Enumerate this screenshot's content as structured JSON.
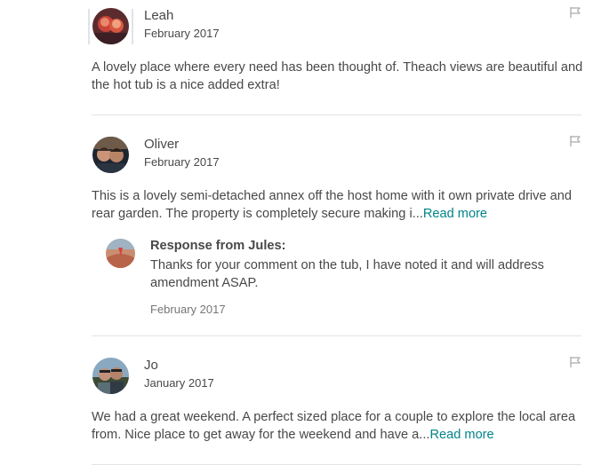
{
  "reviews": [
    {
      "author": "Leah",
      "date": "February 2017",
      "text": "A lovely place where every need has been thought of. Theach views are beautiful and the hot tub is a nice added extra!",
      "avatar_icon": "user-avatar"
    },
    {
      "author": "Oliver",
      "date": "February 2017",
      "text": "This is a lovely semi-detached annex off the host home with it own private drive and rear garden. The property is completely secure making i...",
      "read_more": "Read more",
      "avatar_icon": "user-avatar",
      "response": {
        "heading": "Response from Jules:",
        "text": "Thanks for your comment on the tub, I have noted it and will address amendment ASAP.",
        "date": "February 2017"
      }
    },
    {
      "author": "Jo",
      "date": "January 2017",
      "text": "We had a great weekend. A perfect sized place for a couple to explore the local area from. Nice place to get away for the weekend and have a...",
      "read_more": "Read more",
      "avatar_icon": "user-avatar"
    }
  ],
  "icons": {
    "flag": "flag-icon"
  },
  "colors": {
    "text": "#484848",
    "link": "#008489",
    "muted": "#767676",
    "divider": "#e4e4e4"
  }
}
